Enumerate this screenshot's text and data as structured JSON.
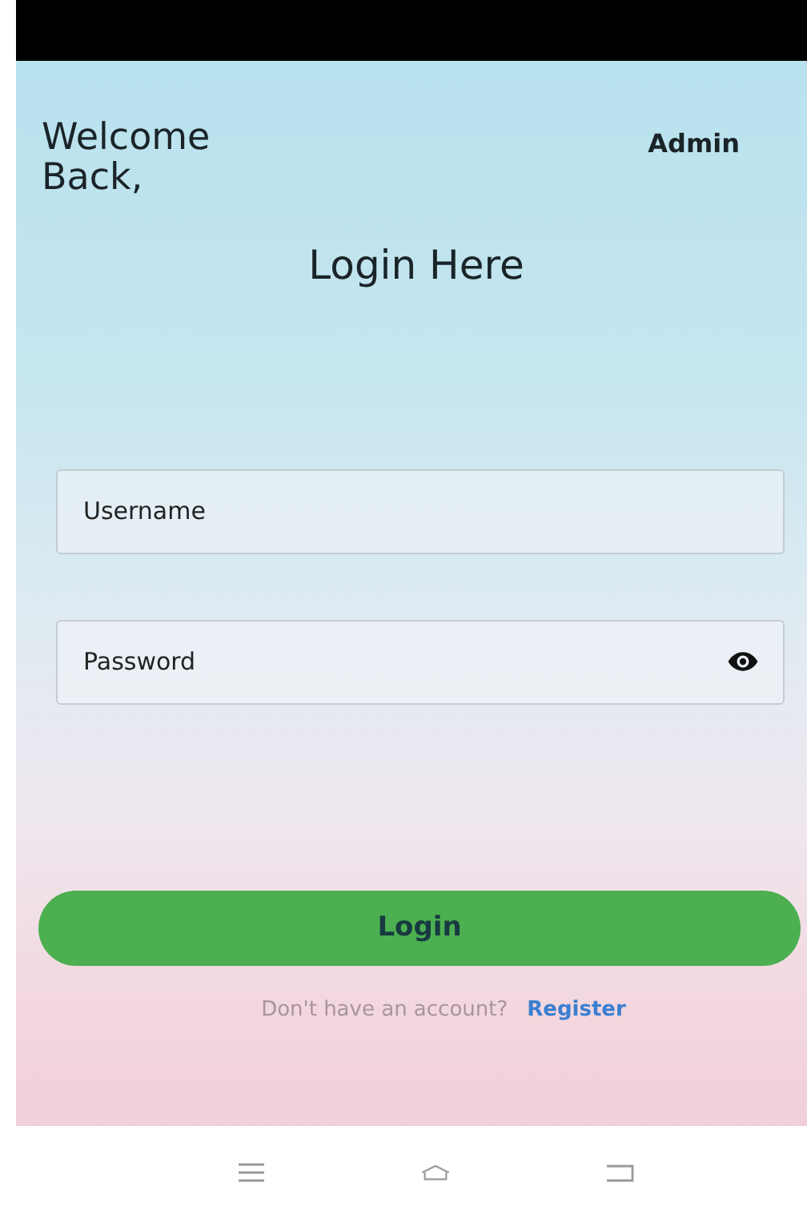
{
  "header": {
    "greeting": "Welcome Back,",
    "role": "Admin"
  },
  "title": "Login Here",
  "fields": [
    {
      "placeholder": "Username",
      "kind": "text"
    },
    {
      "placeholder": "Password",
      "kind": "password"
    }
  ],
  "login_button": "Login",
  "register_prompt": {
    "text": "Don't have an account?",
    "link": "Register"
  }
}
